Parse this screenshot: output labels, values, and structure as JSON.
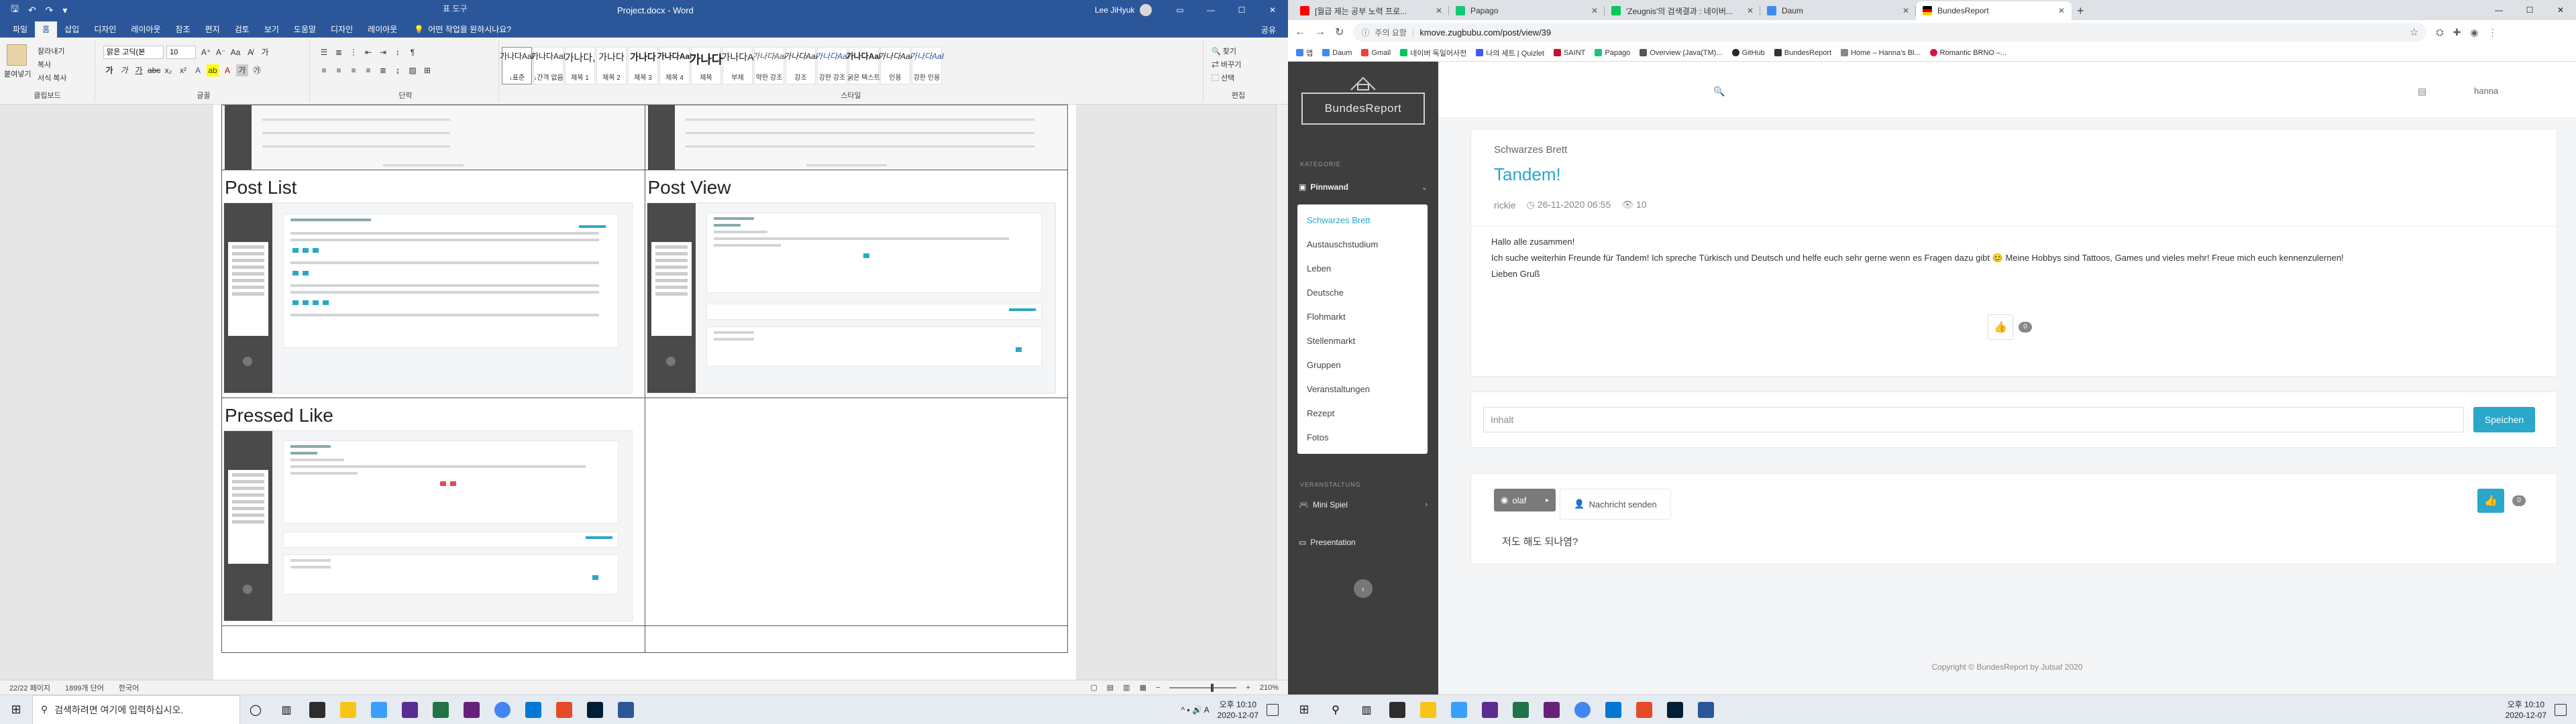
{
  "word": {
    "qat_icons": [
      "save-icon",
      "undo-icon",
      "redo-icon",
      "dropdown-icon"
    ],
    "context_tool": "표 도구",
    "doc_title": "Project.docx - Word",
    "user": "Lee JiHyuk",
    "tabs": [
      "파일",
      "홈",
      "삽입",
      "디자인",
      "레이아웃",
      "참조",
      "편지",
      "검토",
      "보기",
      "도움말",
      "디자인",
      "레이아웃"
    ],
    "active_tab": 1,
    "tell_me": "어떤 작업을 원하시나요?",
    "share": "공유",
    "clipboard": {
      "paste": "붙여넣기",
      "cut": "잘라내기",
      "copy": "복사",
      "format_painter": "서식 복사",
      "label": "클립보드"
    },
    "font": {
      "name": "맑은 고딕(본",
      "size": "10",
      "label": "글꼴"
    },
    "paragraph_label": "단락",
    "styles_label": "스타일",
    "styles": [
      {
        "sample": "가나다AaI",
        "name": "↓표준"
      },
      {
        "sample": "가나다AaI",
        "name": "↓간격 없음"
      },
      {
        "sample": "가나다,",
        "name": "제목 1"
      },
      {
        "sample": "가나다",
        "name": "제목 2"
      },
      {
        "sample": "가나다",
        "name": "제목 3"
      },
      {
        "sample": "가나다AaI",
        "name": "제목 4"
      },
      {
        "sample": "가나다",
        "name": "제목"
      },
      {
        "sample": "가나다A",
        "name": "부제"
      },
      {
        "sample": "가나다AaI",
        "name": "약한 강조"
      },
      {
        "sample": "가나다AaI",
        "name": "강조"
      },
      {
        "sample": "가나다AaI",
        "name": "강한 강조"
      },
      {
        "sample": "가나다AaI",
        "name": "굵은 텍스트"
      },
      {
        "sample": "가나다AaI",
        "name": "인용"
      },
      {
        "sample": "가나다AaI",
        "name": "강한 인용"
      }
    ],
    "editing": {
      "find": "찾기",
      "replace": "바꾸기",
      "select": "선택",
      "label": "편집"
    },
    "table_cells": [
      "Post List",
      "Post View",
      "Pressed Like",
      ""
    ],
    "status": {
      "page": "22/22 페이지",
      "words": "1899개 단어",
      "language": "한국어",
      "zoom": "210%"
    }
  },
  "chrome": {
    "tabs": [
      {
        "title": "[월급 제는 공부 노력 프로...",
        "color": "#ff0000",
        "active": false
      },
      {
        "title": "Papago",
        "color": "#18c776",
        "active": false
      },
      {
        "title": "'Zeugnis'의 검색결과 : 네이버...",
        "color": "#03c75a",
        "active": false
      },
      {
        "title": "Daum",
        "color": "#3f8bf3",
        "active": false
      },
      {
        "title": "BundesReport",
        "color": "#000000",
        "active": true
      }
    ],
    "new_tab": "+",
    "omnibox": {
      "security": "주의 요함",
      "url": "kmove.zugbubu.com/post/view/39"
    },
    "bookmarks": [
      {
        "label": "앱",
        "color": "#4285f4"
      },
      {
        "label": "Daum",
        "color": "#3f8bf3"
      },
      {
        "label": "Gmail",
        "color": "#ea4335"
      },
      {
        "label": "네이버 독일어사전",
        "color": "#03c75a"
      },
      {
        "label": "나의 세트 | Quizlet",
        "color": "#4255ff"
      },
      {
        "label": "SAINT",
        "color": "#c41230"
      },
      {
        "label": "Papago",
        "color": "#18c776"
      },
      {
        "label": "Overview (Java(TM)...",
        "color": "#555555"
      },
      {
        "label": "GitHub",
        "color": "#24292e"
      },
      {
        "label": "BundesReport",
        "color": "#333333"
      },
      {
        "label": "Home – Hanna's Bl...",
        "color": "#888888"
      },
      {
        "label": "Romantic BRNO –...",
        "color": "#d14"
      }
    ]
  },
  "app": {
    "logo": "BundesReport",
    "kategorie_label": "KATEGORIE",
    "pinnwand": "Pinnwand",
    "menu": [
      "Schwarzes Brett",
      "Austauschstudium",
      "Leben",
      "Deutsche",
      "Flohmarkt",
      "Stellenmarkt",
      "Gruppen",
      "Veranstaltungen",
      "Rezept",
      "Fotos"
    ],
    "active_menu": 0,
    "verantaltung_label": "VERANSTALTUNG",
    "mini_spiel": "Mini Spiel",
    "presentation": "Presentation",
    "top_user": "hanna",
    "post": {
      "category": "Schwarzes Brett",
      "title": "Tandem!",
      "author": "rickie",
      "date": "26-11-2020 06:55",
      "views": "10",
      "body": [
        "Hallo alle zusammen!",
        "Ich suche weiterhin Freunde für Tandem! Ich spreche Türkisch und Deutsch und helfe euch sehr gerne wenn es Fragen dazu gibt 😊 Meine Hobbys sind Tattoos, Games und vieles mehr! Freue mich euch kennenzulernen!",
        "Lieben Gruß"
      ],
      "likes": "0"
    },
    "comment_form": {
      "placeholder": "Inhalt",
      "save": "Speichen"
    },
    "comment": {
      "author": "olaf",
      "send_message": "Nachricht senden",
      "text": "저도 해도 되나염?",
      "likes": "0"
    },
    "footer": "Copyright © BundesReport by Jutsaf 2020"
  },
  "taskbar": {
    "search_placeholder": "검색하려면 여기에 입력하십시오.",
    "left_clock": {
      "time": "오후 10:10",
      "date": "2020-12-07"
    },
    "right_clock": {
      "time": "오후 10:10",
      "date": "2020-12-07"
    },
    "apps": [
      "#2d2d2d",
      "#f5c518",
      "#3aa0ff",
      "#5c2d91",
      "#217346",
      "#68217a",
      "#4285f4",
      "#0078d4",
      "#e34c26",
      "#001e36",
      "#2b579a"
    ]
  }
}
